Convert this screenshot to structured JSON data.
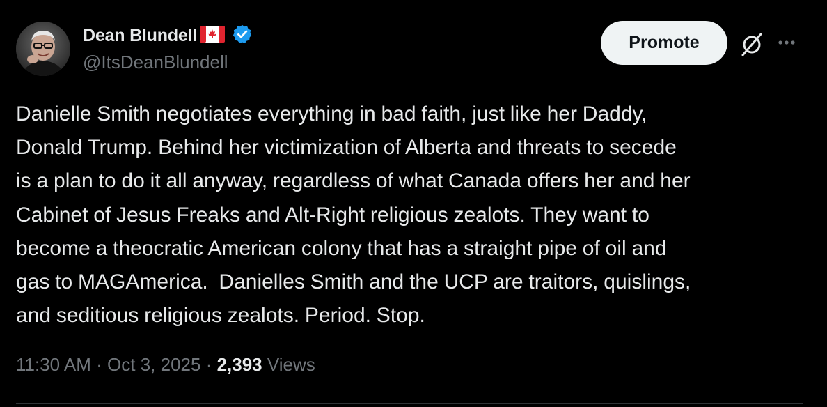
{
  "author": {
    "display_name": "Dean Blundell",
    "flag_icon": "canada-flag-icon",
    "verified_icon": "verified-badge-icon",
    "handle": "@ItsDeanBlundell"
  },
  "actions": {
    "promote_label": "Promote",
    "grok_icon": "grok-icon",
    "more_icon": "more-options-icon"
  },
  "tweet": {
    "text": "Danielle Smith negotiates everything in bad faith, just like her Daddy,\nDonald Trump. Behind her victimization of Alberta and threats to secede\nis a plan to do it all anyway, regardless of what Canada offers her and her\nCabinet of Jesus Freaks and Alt-Right religious zealots. They want to\nbecome a theocratic American colony that has a straight pipe of oil and\ngas to MAGAmerica.  Danielles Smith and the UCP are traitors, quislings,\nand seditious religious zealots. Period. Stop."
  },
  "meta": {
    "time": "11:30 AM",
    "sep1": " · ",
    "date": "Oct 3, 2025",
    "sep2": " · ",
    "views_count": "2,393",
    "views_label": "Views"
  },
  "colors": {
    "background": "#000000",
    "text_primary": "#e7e9ea",
    "text_secondary": "#71767b",
    "verified_blue": "#1d9bf0",
    "promote_bg": "#eff3f4",
    "divider": "#2f3336"
  }
}
